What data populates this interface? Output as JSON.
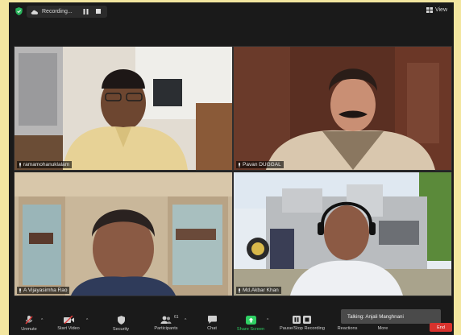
{
  "topbar": {
    "recording_label": "Recording...",
    "view_label": "View"
  },
  "participants_tiles": [
    {
      "name": "ramamohanuklalam"
    },
    {
      "name": "Pavan DUGGAL"
    },
    {
      "name": "A Vijayasimha Rao"
    },
    {
      "name": "Md.Akbar Khan"
    }
  ],
  "toolbar": {
    "unmute": "Unmute",
    "start_video": "Start Video",
    "security": "Security",
    "participants": "Participants",
    "participants_count": "61",
    "chat": "Chat",
    "share_screen": "Share Screen",
    "pause_stop_recording": "Pause/Stop Recording",
    "reactions": "Reactions",
    "more": "More",
    "end": "End"
  },
  "talking": "Talking: Anjali Manghnani",
  "colors": {
    "share_green": "#2fcf63",
    "end_red": "#d8322d",
    "background": "#1a1a1a",
    "frame": "#f3e6a0"
  }
}
